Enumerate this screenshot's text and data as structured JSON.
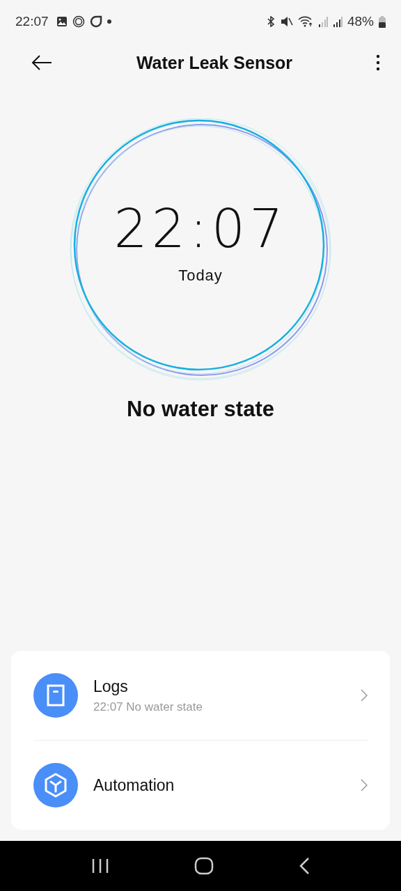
{
  "status_bar": {
    "time": "22:07",
    "battery": "48%"
  },
  "header": {
    "title": "Water Leak Sensor"
  },
  "clock": {
    "time": "22:07",
    "day": "Today"
  },
  "state": "No water state",
  "menu": [
    {
      "kind": "logs",
      "label": "Logs",
      "detail": "22:07 No water state"
    },
    {
      "kind": "automation",
      "label": "Automation"
    }
  ]
}
